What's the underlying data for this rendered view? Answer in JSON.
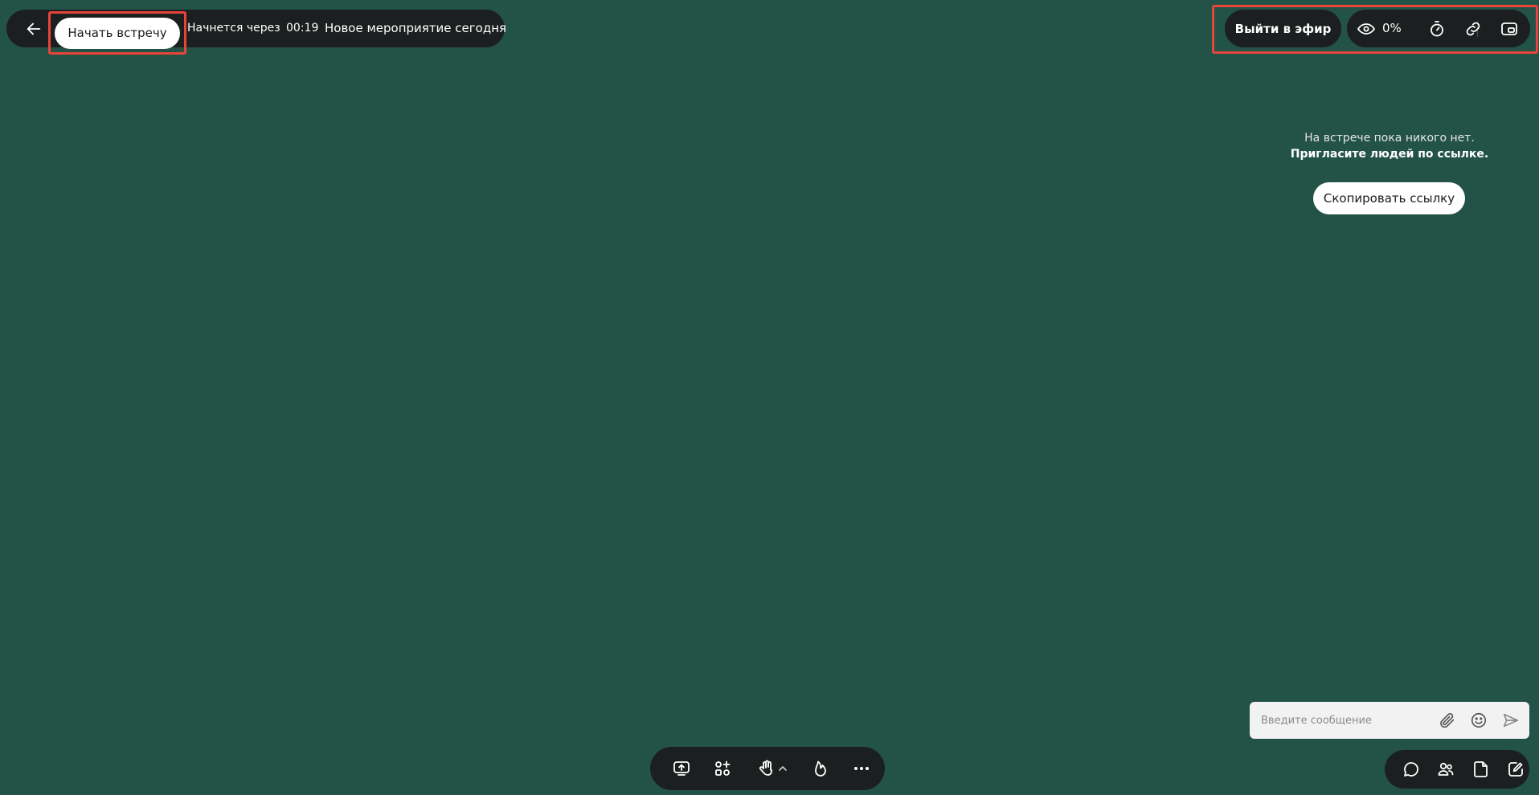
{
  "top_bar": {
    "start_meeting_label": "Начать встречу",
    "starts_in_label": "Начнется через",
    "countdown": "00:19",
    "event_title": "Новое мероприятие сегодня"
  },
  "top_right": {
    "go_live_label": "Выйти в эфир",
    "viewers_percent": "0%"
  },
  "empty_state": {
    "line1": "На встрече пока никого нет.",
    "line2": "Пригласите людей по ссылке.",
    "copy_link_label": "Скопировать ссылку"
  },
  "chat": {
    "message_placeholder": "Введите сообщение"
  },
  "icons": {
    "back": "arrow-left-icon",
    "viewers": "eye-icon",
    "timer": "stopwatch-icon",
    "link": "link-icon",
    "pip": "picture-in-picture-icon",
    "attach": "paperclip-icon",
    "emoji": "smile-icon",
    "send": "send-icon",
    "share_screen": "screen-share-icon",
    "add_apps": "apps-plus-icon",
    "raise_hand": "hand-icon",
    "reactions": "fire-icon",
    "more": "more-dots-icon",
    "chat": "chat-bubble-icon",
    "participants": "people-icon",
    "notes": "note-icon",
    "whiteboard": "edit-board-icon"
  },
  "colors": {
    "background": "#235347",
    "panel": "#1c1f1f",
    "highlight": "#e8443a"
  }
}
